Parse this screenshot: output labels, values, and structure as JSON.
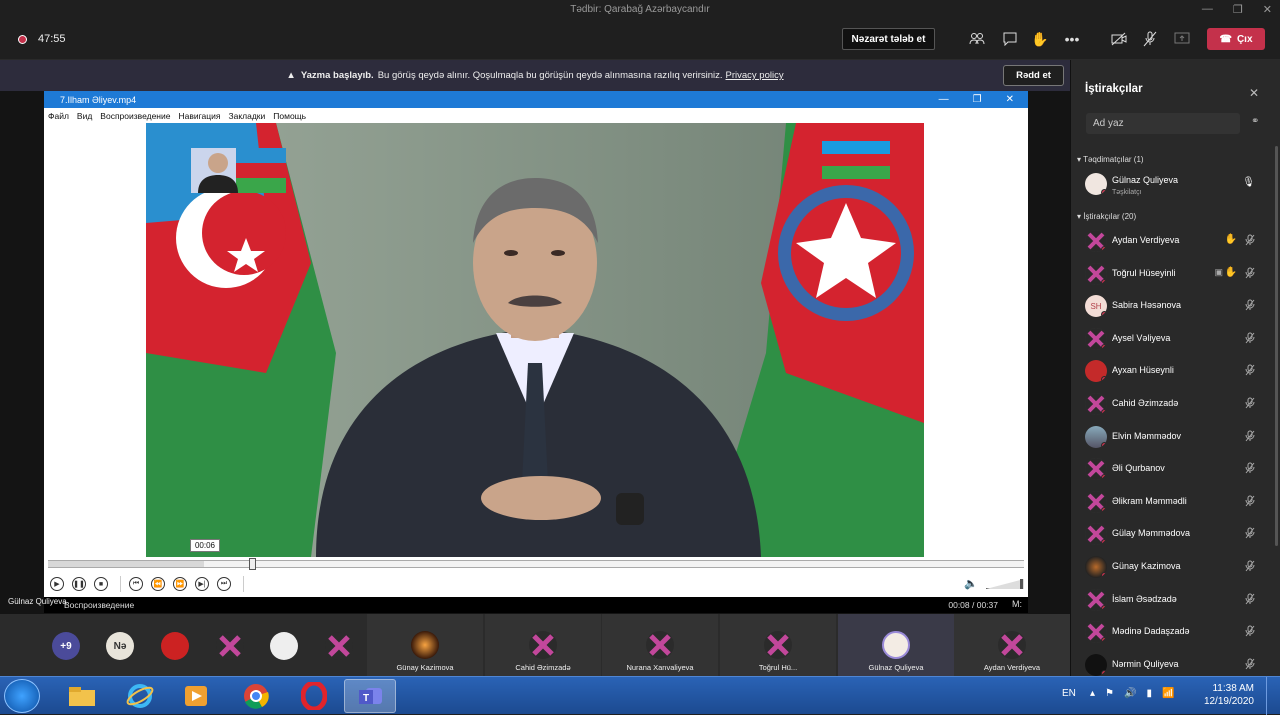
{
  "window": {
    "title": "Tədbir: Qarabağ Azərbaycandır"
  },
  "meeting": {
    "timer": "47:55",
    "request_control": "Nəzarət tələb et",
    "leave": "Çıx",
    "colors": {
      "leave": "#c4314b",
      "recording": "#c4314b"
    }
  },
  "banner": {
    "bold": "Yazma başlayıb.",
    "text": "Bu görüş qeydə alınır. Qoşulmaqla bu görüşün qeydə alınmasına razılıq verirsiniz.",
    "link": "Privacy policy",
    "reject": "Rədd et"
  },
  "player": {
    "title": "7.Ilham Əliyev.mp4",
    "menu": [
      "Файл",
      "Вид",
      "Воспроизведение",
      "Навигация",
      "Закладки",
      "Помощь"
    ],
    "tooltip": "00:06",
    "progress": 0.16,
    "status": "Воспроизведение",
    "time": "00:08 / 00:37",
    "ratio": "M:"
  },
  "presenter_tag": "Gülnaz Quliyeva",
  "strip": {
    "small": [
      {
        "label": "+9",
        "bg": "#4b4b9a"
      },
      {
        "label": "Nə",
        "bg": "#e8e4da",
        "fg": "#333"
      },
      {
        "label": "",
        "bg": "#cc2222"
      },
      {
        "label": "",
        "bg": "#2b2b2b"
      },
      {
        "label": "",
        "bg": "#eee"
      },
      {
        "label": "",
        "bg": "#2b2b2b"
      }
    ],
    "tiles": [
      {
        "name": "Günay Kazimova"
      },
      {
        "name": "Cahid Əzimzadə"
      },
      {
        "name": "Nurana Xanvaliyeva"
      },
      {
        "name": "Toğrul Hü..."
      },
      {
        "name": "Gülnaz Quliyeva"
      },
      {
        "name": "Aydan Verdiyeva"
      }
    ]
  },
  "panel": {
    "title": "İştirakçılar",
    "search_placeholder": "Ad yaz",
    "presenters_header": "Təqdimatçılar (1)",
    "attendees_header": "İştirakçılar (20)",
    "presenter": {
      "name": "Gülnaz Quliyeva",
      "role": "Təşkilatçı"
    },
    "attendees": [
      {
        "name": "Aydan Verdiyeva",
        "hand": true
      },
      {
        "name": "Toğrul Hüseyinli",
        "hand": true,
        "screen": true
      },
      {
        "name": "Sabira Həsənova",
        "initials": "SH"
      },
      {
        "name": "Aysel Vəliyeva"
      },
      {
        "name": "Ayxan Hüseynli"
      },
      {
        "name": "Cahid Əzimzadə"
      },
      {
        "name": "Elvin Məmmədov"
      },
      {
        "name": "Əli Qurbanov"
      },
      {
        "name": "Əlikram Məmmədli"
      },
      {
        "name": "Gülay Məmmədova"
      },
      {
        "name": "Günay Kazimova"
      },
      {
        "name": "İslam Əsədzadə"
      },
      {
        "name": "Mədinə Dadaşzadə"
      },
      {
        "name": "Nərmin Quliyeva"
      }
    ]
  },
  "taskbar": {
    "lang": "EN",
    "time": "11:38 AM",
    "date": "12/19/2020"
  }
}
